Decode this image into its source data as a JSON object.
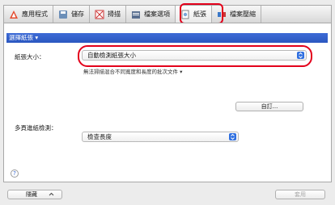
{
  "tabs": [
    {
      "label": "應用程式",
      "icon": "app-icon"
    },
    {
      "label": "儲存",
      "icon": "save-icon"
    },
    {
      "label": "掃描",
      "icon": "scan-icon"
    },
    {
      "label": "檔案選項",
      "icon": "file-options-icon"
    },
    {
      "label": "紙張",
      "icon": "paper-icon"
    },
    {
      "label": "檔案壓縮",
      "icon": "compress-icon"
    }
  ],
  "section": {
    "title": "選擇紙張 ▾"
  },
  "paper_size": {
    "label": "紙張大小：",
    "value": "自動檢測紙張大小",
    "note": "無法掃描混合不同寬度和長度的批次文件 ▾"
  },
  "custom_button": "自訂...",
  "multifeed": {
    "label": "多頁進紙檢測：",
    "value": "檢查長度"
  },
  "help": "?",
  "footer": {
    "hide_button": "隱藏",
    "apply_button": "套用"
  },
  "colors": {
    "highlight": "#e3001b",
    "section_header": "#2b57c0"
  }
}
